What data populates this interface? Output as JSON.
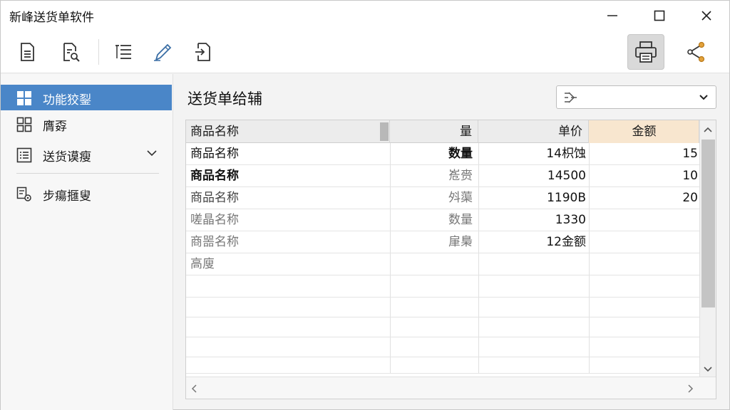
{
  "window": {
    "title": "新峰送货单软件"
  },
  "toolbar": {
    "buttons": [
      {
        "icon": "document-icon"
      },
      {
        "icon": "document-search-icon"
      },
      {
        "icon": "list-icon"
      },
      {
        "icon": "pen-icon"
      },
      {
        "icon": "export-icon"
      },
      {
        "icon": "printer-icon",
        "active": true
      },
      {
        "icon": "share-icon"
      }
    ]
  },
  "sidebar": {
    "items": [
      {
        "label": "功能狡銐",
        "icon": "grid-icon",
        "selected": true
      },
      {
        "label": "膺孬",
        "icon": "tiles-icon"
      },
      {
        "label": "送货谟瘦",
        "icon": "list-box-icon",
        "expandable": true
      },
      {
        "label": "步瘍擓叟",
        "icon": "settings-doc-icon"
      }
    ]
  },
  "main": {
    "title": "送货单给辅",
    "filter": {
      "value": ""
    }
  },
  "grid": {
    "columns": [
      "商品名称",
      "量",
      "单价",
      "金额"
    ],
    "rows": [
      [
        "商品名称",
        "数量",
        "14枳蚀",
        "15"
      ],
      [
        "商品名称",
        "峞赍",
        "14500",
        "10"
      ],
      [
        "商品名称",
        "斘蕖",
        "1190B",
        "20"
      ],
      [
        "嗟晶名称",
        "数量",
        "1330",
        ""
      ],
      [
        "商噐名称",
        "肁梟",
        "12金额",
        ""
      ],
      [
        "高廋",
        "",
        "",
        ""
      ]
    ]
  },
  "colors": {
    "accent": "#4a86c8",
    "amount_header": "#f8e6cf",
    "printer_active": "#d9d9d9"
  }
}
